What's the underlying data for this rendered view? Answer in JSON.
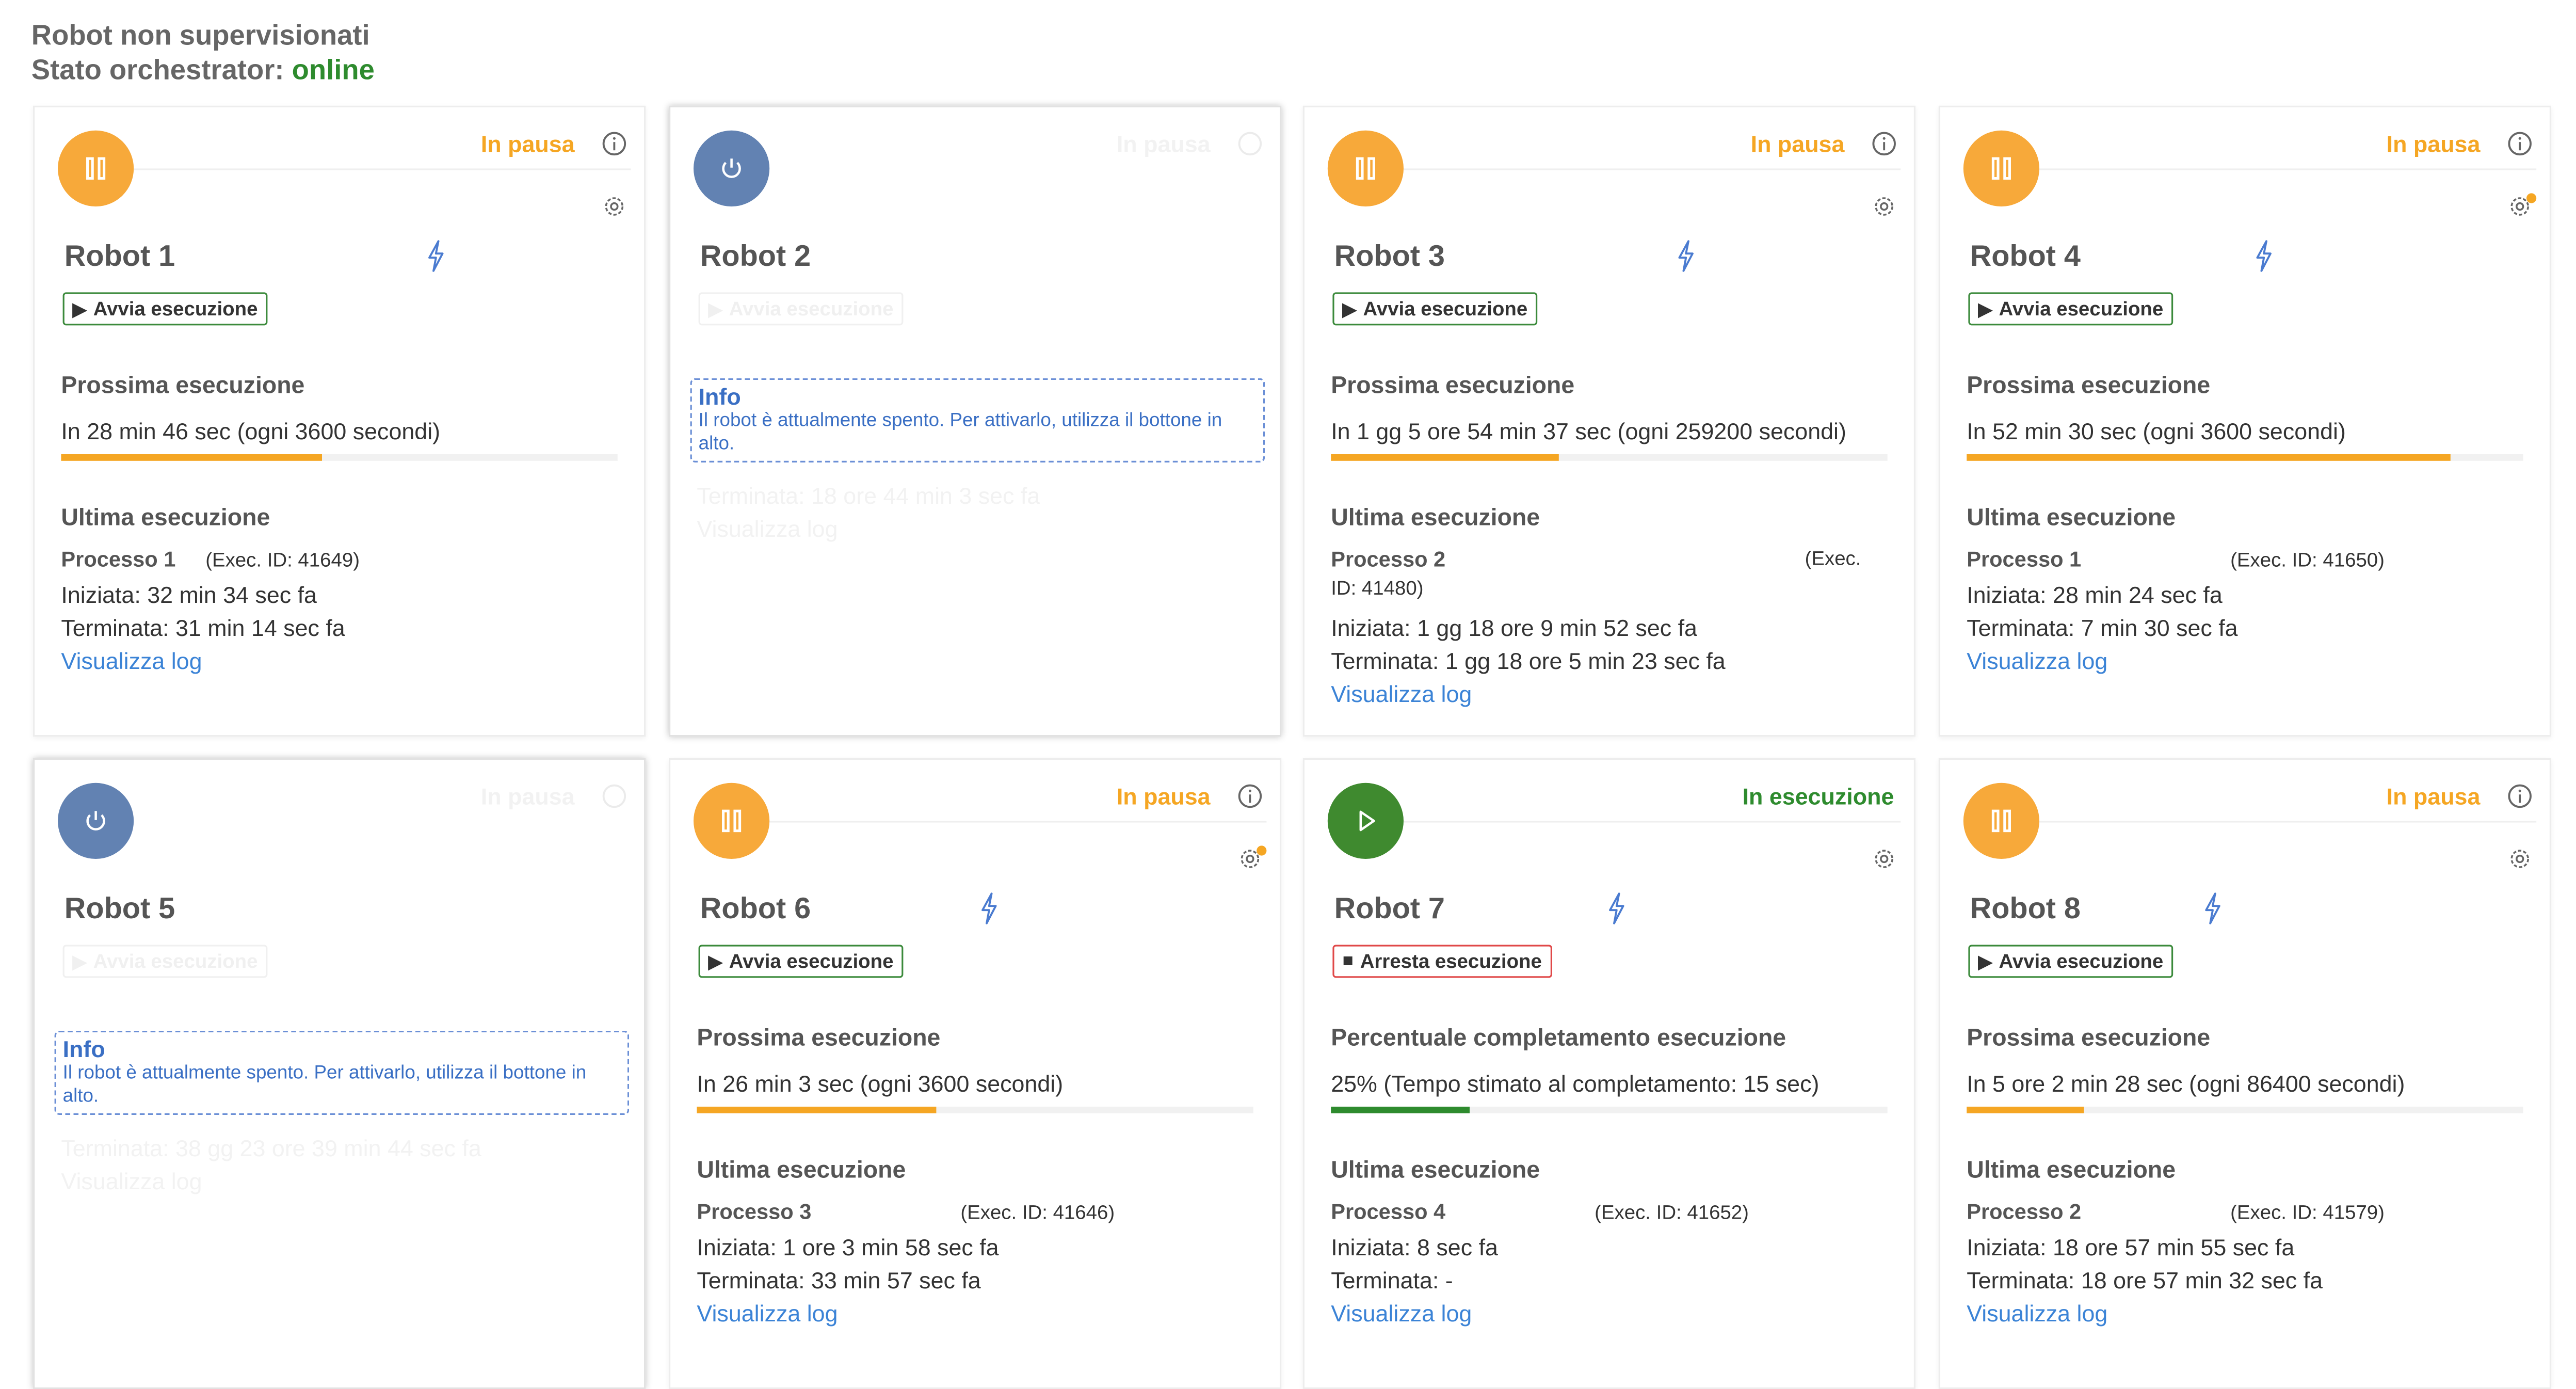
{
  "header": {
    "title": "Robot non supervisionati",
    "orchestrator_label": "Stato orchestrator:",
    "orchestrator_status": "online"
  },
  "colors": {
    "paused": "#f5a623",
    "running": "#2e8b2e",
    "off": "#6282b2",
    "link": "#3b83d6",
    "stop": "#e04848"
  },
  "labels": {
    "start": "Avvia esecuzione",
    "stop": "Arresta esecuzione",
    "next_run": "Prossima esecuzione",
    "last_run": "Ultima esecuzione",
    "completion": "Percentuale completamento esecuzione",
    "view_log": "Visualizza log",
    "info_title": "Info",
    "info_text": "Il robot è attualmente spento. Per attivarlo, utilizza il bottone in alto."
  },
  "robots": [
    {
      "name": "Robot 1",
      "status": "In pausa",
      "next": "In 28 min 46 sec (ogni 3600 secondi)",
      "progress": 0.47,
      "process": "Processo 1",
      "exec_id": "(Exec. ID: 41649)",
      "started": "Iniziata: 32 min 34 sec fa",
      "ended": "Terminata: 31 min 14 sec fa"
    },
    {
      "name": "Robot 2",
      "status": "In pausa",
      "ended": "Terminata: 18 ore 44 min 3 sec fa"
    },
    {
      "name": "Robot 3",
      "status": "In pausa",
      "next": "In 1 gg 5 ore 54 min 37 sec (ogni 259200 secondi)",
      "progress": 0.41,
      "process": "Processo 2",
      "exec_id_a": "(Exec.",
      "exec_id_b": "ID: 41480)",
      "started": "Iniziata: 1 gg 18 ore 9 min 52 sec fa",
      "ended": "Terminata: 1 gg 18 ore 5 min 23 sec fa"
    },
    {
      "name": "Robot 4",
      "status": "In pausa",
      "next": "In 52 min 30 sec (ogni 3600 secondi)",
      "progress": 0.87,
      "process": "Processo 1",
      "exec_id": "(Exec. ID: 41650)",
      "started": "Iniziata: 28 min 24 sec fa",
      "ended": "Terminata: 7 min 30 sec fa"
    },
    {
      "name": "Robot 5",
      "status": "In pausa",
      "ended": "Terminata: 38 gg 23 ore 39 min 44 sec fa"
    },
    {
      "name": "Robot 6",
      "status": "In pausa",
      "next": "In 26 min 3 sec (ogni 3600 secondi)",
      "progress": 0.43,
      "process": "Processo 3",
      "exec_id": "(Exec. ID: 41646)",
      "started": "Iniziata: 1 ore 3 min 58 sec fa",
      "ended": "Terminata: 33 min 57 sec fa"
    },
    {
      "name": "Robot 7",
      "status": "In esecuzione",
      "next": "25% (Tempo stimato al completamento: 15 sec)",
      "progress": 0.25,
      "process": "Processo 4",
      "exec_id": "(Exec. ID: 41652)",
      "started": "Iniziata: 8 sec fa",
      "ended": "Terminata: -"
    },
    {
      "name": "Robot 8",
      "status": "In pausa",
      "next": "In 5 ore 2 min 28 sec (ogni 86400 secondi)",
      "progress": 0.21,
      "process": "Processo 2",
      "exec_id": "(Exec. ID: 41579)",
      "started": "Iniziata: 18 ore 57 min 55 sec fa",
      "ended": "Terminata: 18 ore 57 min 32 sec fa"
    }
  ]
}
